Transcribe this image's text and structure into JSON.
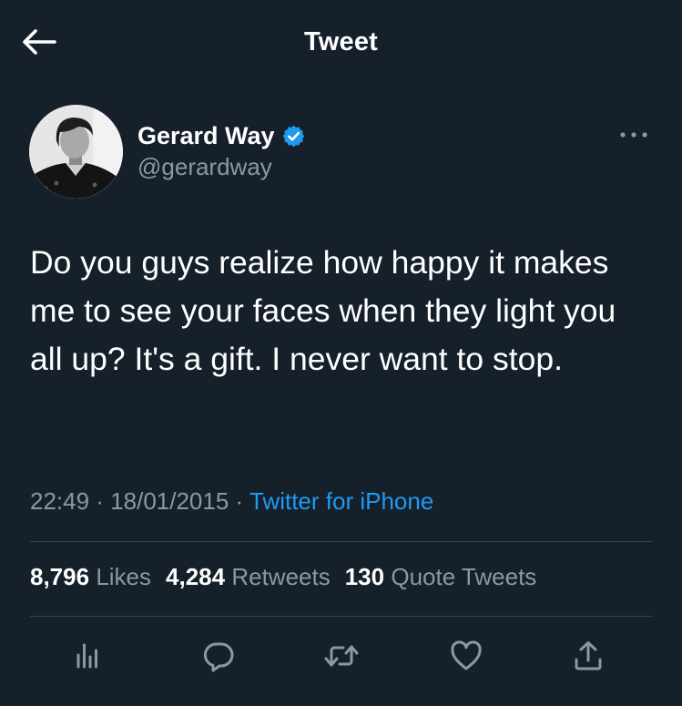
{
  "header": {
    "title": "Tweet",
    "back_icon": "arrow-left-icon"
  },
  "author": {
    "name": "Gerard Way",
    "handle": "@gerardway",
    "verified": true,
    "verified_icon": "verified-badge-icon",
    "avatar_icon": "avatar-photo"
  },
  "more_icon": "more-horizontal-icon",
  "tweet": {
    "text": "Do you guys realize how happy it makes me to see your faces when they light you all up? It's a gift. I never want to stop."
  },
  "meta": {
    "time": "22:49",
    "separator1": " · ",
    "date": "18/01/2015",
    "separator2": " · ",
    "source": "Twitter for iPhone"
  },
  "stats": {
    "likes_count": "8,796",
    "likes_label": "Likes",
    "retweets_count": "4,284",
    "retweets_label": "Retweets",
    "quotes_count": "130",
    "quotes_label": "Quote Tweets"
  },
  "actions": [
    {
      "name": "analytics",
      "icon": "analytics-icon"
    },
    {
      "name": "reply",
      "icon": "reply-icon"
    },
    {
      "name": "retweet",
      "icon": "retweet-icon"
    },
    {
      "name": "like",
      "icon": "heart-icon"
    },
    {
      "name": "share",
      "icon": "share-icon"
    }
  ],
  "colors": {
    "background": "#15202b",
    "text_primary": "#ffffff",
    "text_secondary": "#8899a6",
    "accent": "#1d9bf0",
    "divider": "#38444d"
  }
}
